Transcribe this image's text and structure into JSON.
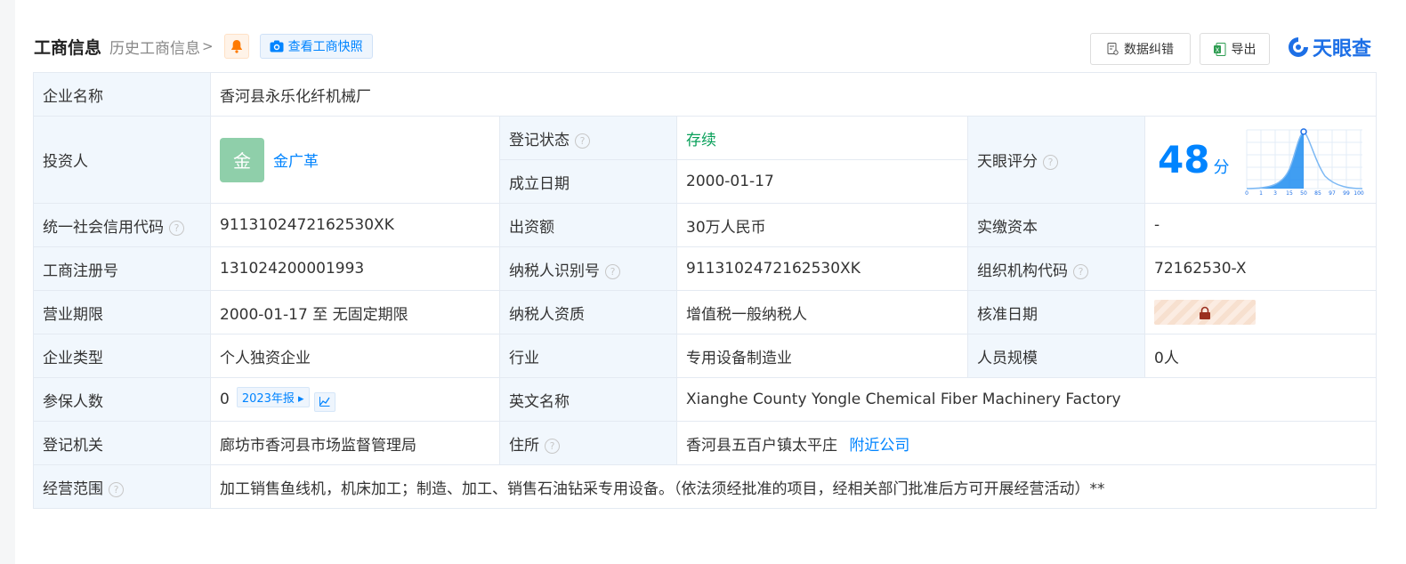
{
  "header": {
    "title": "工商信息",
    "history_link": "历史工商信息",
    "chevron": ">",
    "bell_icon": "bell-icon",
    "snapshot_btn": "查看工商快照",
    "error_btn": "数据纠错",
    "export_btn": "导出",
    "logo_text": "天眼查"
  },
  "colors": {
    "accent": "#0084ff",
    "status_green": "#09a05a",
    "label_bg": "#f1f7fd",
    "avatar_bg": "#8fcfaa"
  },
  "rows": {
    "company_name_label": "企业名称",
    "company_name": "香河县永乐化纤机械厂",
    "investor_label": "投资人",
    "investor_avatar": "金",
    "investor_name": "金广革",
    "reg_status_label": "登记状态",
    "reg_status": "存续",
    "found_date_label": "成立日期",
    "found_date": "2000-01-17",
    "score_label": "天眼评分",
    "score_value": "48",
    "score_unit": "分",
    "score_axis": [
      "0",
      "1",
      "3",
      "15",
      "50",
      "85",
      "97",
      "99",
      "100"
    ],
    "credit_code_label": "统一社会信用代码",
    "credit_code": "9113102472162530XK",
    "capital_label": "出资额",
    "capital": "30万人民币",
    "paid_capital_label": "实缴资本",
    "paid_capital": "-",
    "reg_no_label": "工商注册号",
    "reg_no": "131024200001993",
    "taxpayer_id_label": "纳税人识别号",
    "taxpayer_id": "9113102472162530XK",
    "org_code_label": "组织机构代码",
    "org_code": "72162530-X",
    "term_label": "营业期限",
    "term": "2000-01-17 至 无固定期限",
    "taxpayer_qual_label": "纳税人资质",
    "taxpayer_qual": "增值税一般纳税人",
    "approve_date_label": "核准日期",
    "company_type_label": "企业类型",
    "company_type": "个人独资企业",
    "industry_label": "行业",
    "industry": "专用设备制造业",
    "staff_label": "人员规模",
    "staff": "0人",
    "insured_label": "参保人数",
    "insured": "0",
    "annual_report_tag": "2023年报",
    "english_name_label": "英文名称",
    "english_name": "Xianghe County Yongle Chemical Fiber Machinery Factory",
    "authority_label": "登记机关",
    "authority": "廊坊市香河县市场监督管理局",
    "address_label": "住所",
    "address": "香河县五百户镇太平庄",
    "nearby_link": "附近公司",
    "scope_label": "经营范围",
    "scope": "加工销售鱼线机，机床加工；制造、加工、销售石油钻采专用设备。（依法须经批准的项目，经相关部门批准后方可开展经营活动）**"
  }
}
